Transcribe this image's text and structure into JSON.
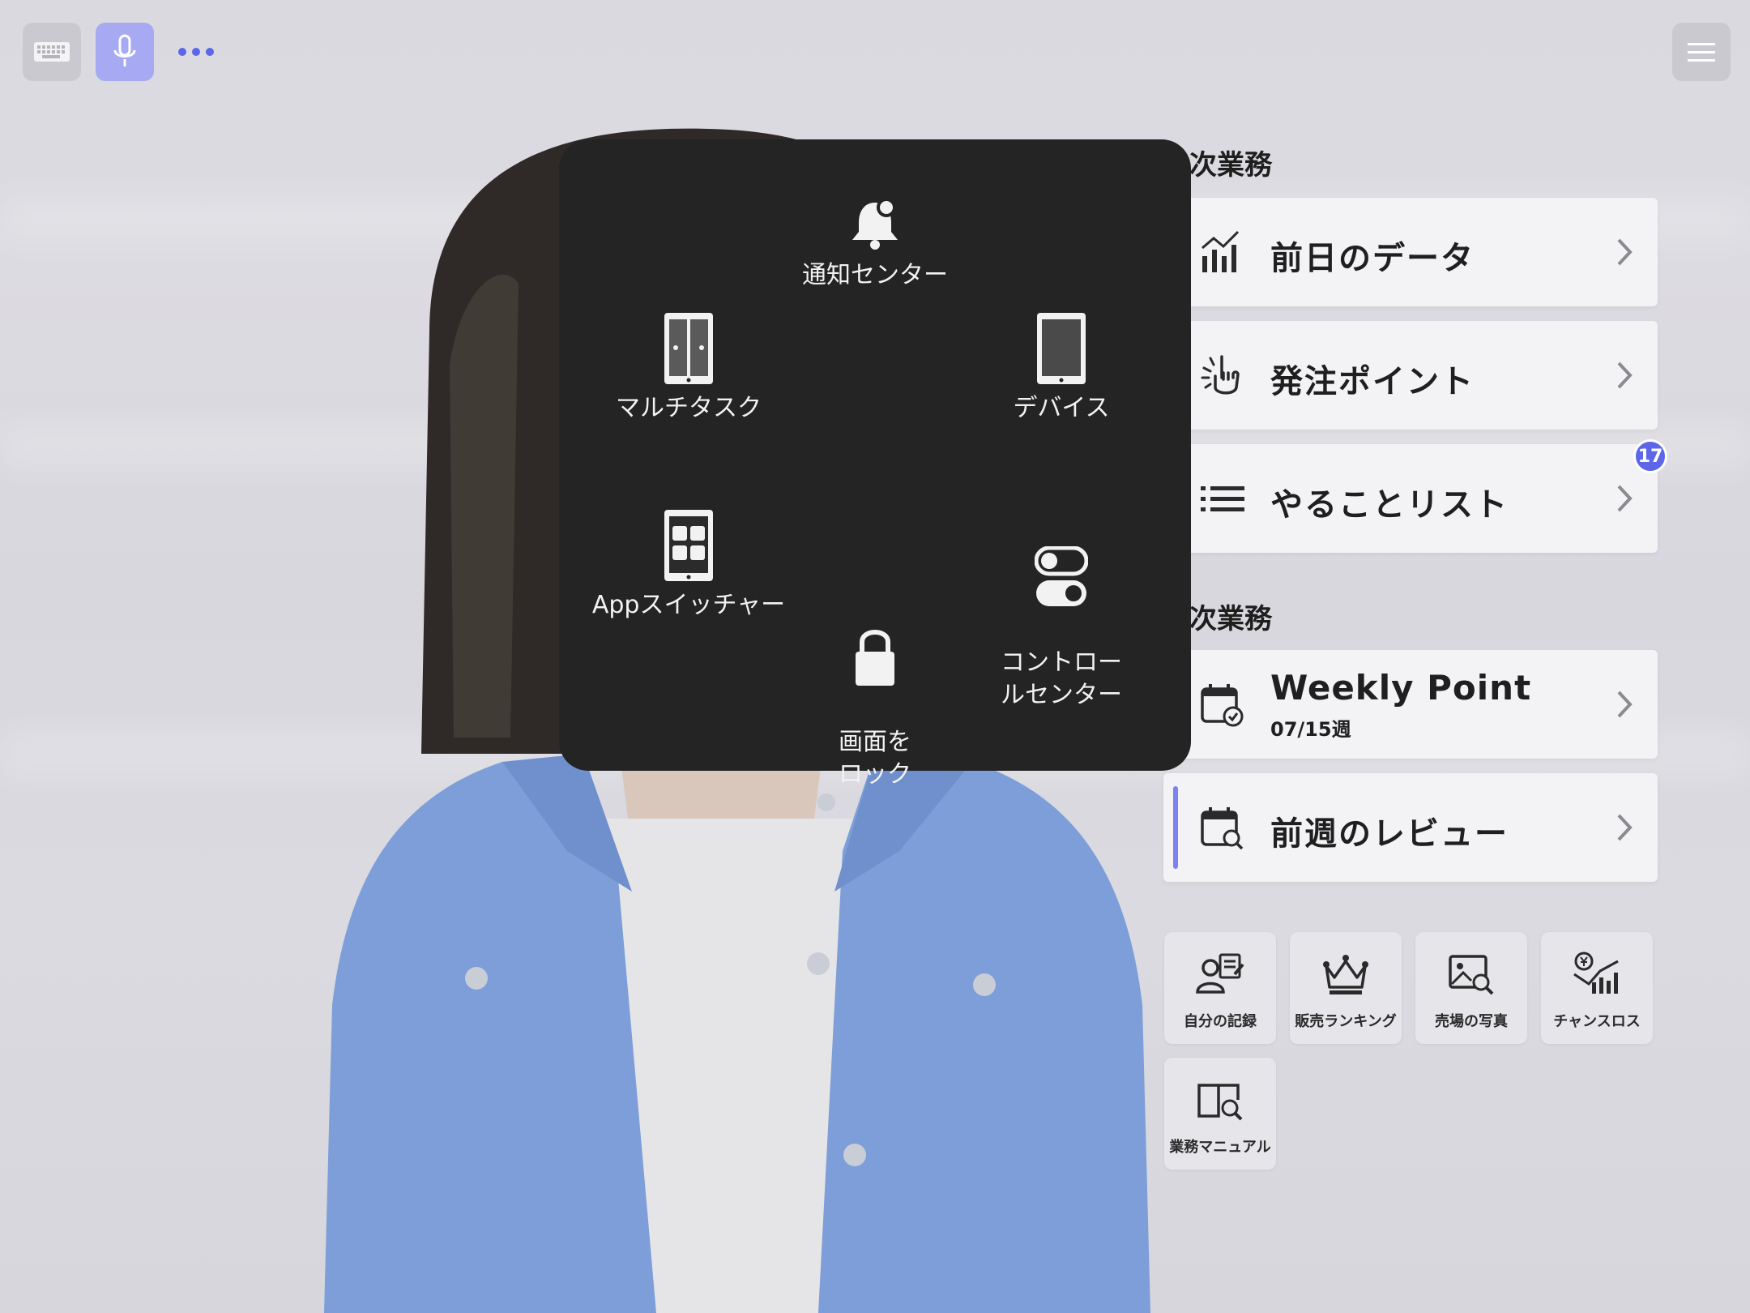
{
  "toolbar": {
    "keyboard_icon": "keyboard-icon",
    "mic_icon": "microphone-icon",
    "more_icon": "more-dots-icon",
    "menu_icon": "hamburger-menu-icon"
  },
  "colors": {
    "accent": "#5d66e8",
    "mic_bg": "#a7a9f2",
    "overlay_bg": "#242424",
    "card_bg": "#f3f3f6"
  },
  "assistive_menu": {
    "items": [
      {
        "label": "通知センター",
        "icon": "bell-icon"
      },
      {
        "label": "マルチタスク",
        "icon": "multitask-icon"
      },
      {
        "label": "デバイス",
        "icon": "tablet-icon"
      },
      {
        "label": "Appスイッチャー",
        "icon": "app-switcher-icon"
      },
      {
        "label": "コントロー\nルセンター",
        "icon": "toggle-icon"
      },
      {
        "label": "画面を\nロック",
        "icon": "lock-icon"
      }
    ]
  },
  "daily": {
    "section_title": "次業務",
    "cards": [
      {
        "label": "前日のデータ",
        "icon": "bar-chart-icon"
      },
      {
        "label": "発注ポイント",
        "icon": "pointing-hand-icon"
      },
      {
        "label": "やることリスト",
        "icon": "list-icon",
        "badge": "17"
      }
    ]
  },
  "weekly": {
    "section_title": "次業務",
    "cards": [
      {
        "label": "Weekly Point",
        "sub": "07/15週",
        "icon": "calendar-check-icon"
      },
      {
        "label": "前週のレビュー",
        "icon": "calendar-search-icon",
        "selected": true
      }
    ]
  },
  "tiles": [
    {
      "label": "自分の記録",
      "icon": "user-record-icon"
    },
    {
      "label": "販売ランキング",
      "icon": "crown-icon"
    },
    {
      "label": "売場の写真",
      "icon": "photo-search-icon"
    },
    {
      "label": "チャンスロス",
      "icon": "yen-chart-icon"
    },
    {
      "label": "業務マニュアル",
      "icon": "manual-book-icon"
    }
  ]
}
